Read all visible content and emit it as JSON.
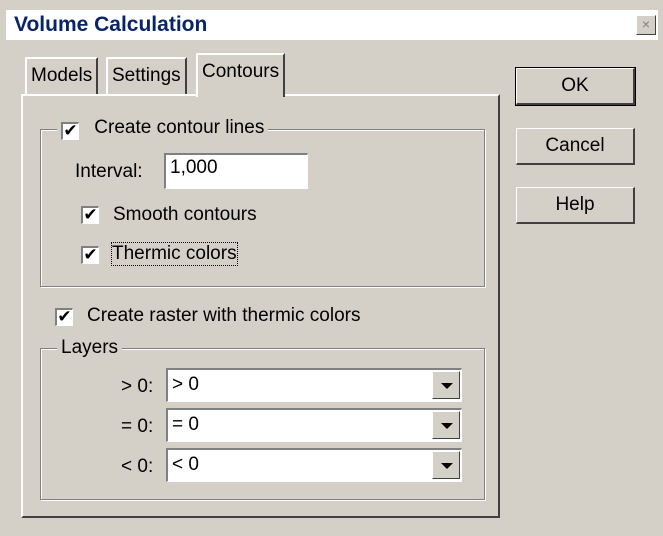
{
  "window": {
    "title": "Volume Calculation",
    "close_glyph": "×"
  },
  "tabs": [
    {
      "label": "Models",
      "active": false
    },
    {
      "label": "Settings",
      "active": false
    },
    {
      "label": "Contours",
      "active": true
    }
  ],
  "contours": {
    "create_contour_lines": {
      "label": "Create contour lines",
      "checked": true
    },
    "interval": {
      "label": "Interval:",
      "value": "1,000"
    },
    "smooth_contours": {
      "label": "Smooth contours",
      "checked": true
    },
    "thermic_colors": {
      "label": "Thermic colors",
      "checked": true
    }
  },
  "raster": {
    "create_raster": {
      "label": "Create raster with thermic colors",
      "checked": true
    }
  },
  "layers": {
    "group_label": "Layers",
    "rows": [
      {
        "label": "> 0:",
        "value": "> 0"
      },
      {
        "label": "= 0:",
        "value": "= 0"
      },
      {
        "label": "< 0:",
        "value": "< 0"
      }
    ]
  },
  "buttons": {
    "ok": "OK",
    "cancel": "Cancel",
    "help": "Help"
  },
  "check_glyph": "✔"
}
